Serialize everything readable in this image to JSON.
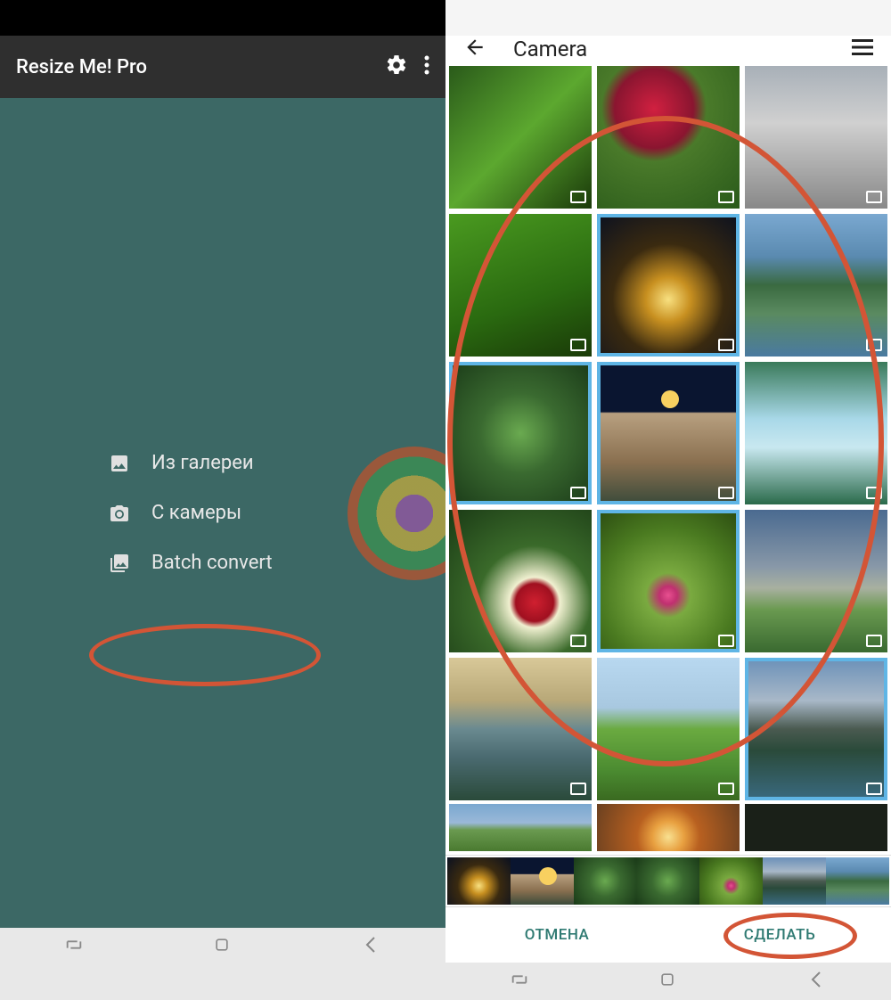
{
  "left": {
    "app_title": "Resize Me! Pro",
    "menu": {
      "gallery": "Из галереи",
      "camera": "С камеры",
      "batch": "Batch convert"
    }
  },
  "right": {
    "title": "Camera",
    "actions": {
      "cancel": "ОТМЕНА",
      "done": "СДЕЛАТЬ"
    }
  },
  "grid": [
    {
      "name": "grass-macro",
      "cls": "p-grass",
      "selected": false
    },
    {
      "name": "raspberry",
      "cls": "p-berry",
      "selected": false
    },
    {
      "name": "grey-wall",
      "cls": "p-wall",
      "selected": false
    },
    {
      "name": "green-leaves",
      "cls": "p-green",
      "selected": false
    },
    {
      "name": "night-tree",
      "cls": "p-night",
      "selected": true
    },
    {
      "name": "lake-forest",
      "cls": "p-lake",
      "selected": false
    },
    {
      "name": "leaf-plant",
      "cls": "p-leaf",
      "selected": true
    },
    {
      "name": "moonrise",
      "cls": "p-moon",
      "selected": true
    },
    {
      "name": "waterfall",
      "cls": "p-waterfall",
      "selected": false
    },
    {
      "name": "strawberries",
      "cls": "p-strawb",
      "selected": false
    },
    {
      "name": "field-flowers",
      "cls": "p-flowers",
      "selected": true
    },
    {
      "name": "cloudy-meadow",
      "cls": "p-sky",
      "selected": false
    },
    {
      "name": "lake-autumn",
      "cls": "p-reflect",
      "selected": false
    },
    {
      "name": "golf-path",
      "cls": "p-golf",
      "selected": false
    },
    {
      "name": "mountain-lake",
      "cls": "p-mountain",
      "selected": true
    }
  ],
  "grid_partial": [
    {
      "name": "rainbow-field",
      "cls": "p-rainbow"
    },
    {
      "name": "sunset",
      "cls": "p-sunset"
    },
    {
      "name": "dark",
      "cls": "p-dark"
    }
  ],
  "strip": [
    "p-night",
    "p-moon",
    "p-leaf",
    "p-leaf",
    "p-flowers",
    "p-mountain",
    "p-lake"
  ]
}
